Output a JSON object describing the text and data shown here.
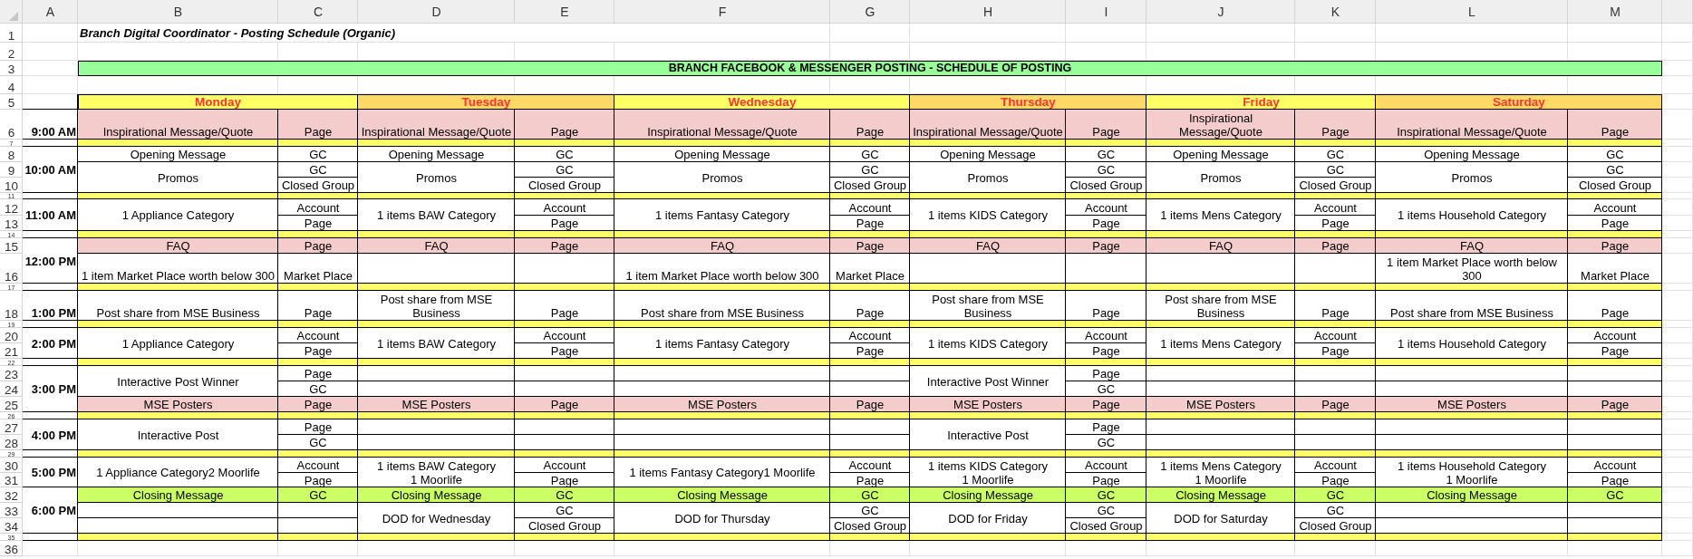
{
  "column_headers": [
    "A",
    "B",
    "C",
    "D",
    "E",
    "F",
    "G",
    "H",
    "I",
    "J",
    "K",
    "L",
    "M"
  ],
  "row_numbers": [
    "1",
    "2",
    "3",
    "4",
    "5",
    "6",
    "7",
    "8",
    "9",
    "10",
    "11",
    "12",
    "13",
    "14",
    "15",
    "16",
    "17",
    "18",
    "19",
    "20",
    "21",
    "22",
    "23",
    "24",
    "25",
    "26",
    "27",
    "28",
    "29",
    "30",
    "31",
    "32",
    "33",
    "34",
    "35",
    "36"
  ],
  "title": "Branch Digital Coordinator - Posting Schedule (Organic)",
  "banner": "BRANCH FACEBOOK & MESSENGER POSTING - SCHEDULE OF POSTING",
  "time_slots": [
    "9:00 AM",
    "10:00 AM",
    "11:00 AM",
    "12:00 PM",
    "1:00 PM",
    "2:00 PM",
    "3:00 PM",
    "4:00 PM",
    "5:00 PM",
    "6:00 PM"
  ],
  "days": [
    {
      "name": "Monday",
      "color": "#ffff66",
      "entries": [
        {
          "kind": "highlight",
          "post": "Inspirational Message/Quote",
          "channels": [
            "Page"
          ]
        },
        {
          "kind": "plain",
          "post": "Opening Message",
          "channels": [
            "GC"
          ]
        },
        {
          "kind": "plain",
          "post": "Promos",
          "channels": [
            "GC",
            "Closed Group"
          ]
        },
        {
          "kind": "plain",
          "post": "1 Appliance Category",
          "channels": [
            "Account",
            "Page"
          ]
        },
        {
          "kind": "highlight",
          "post": "FAQ",
          "channels": [
            "Page"
          ]
        },
        {
          "kind": "plain",
          "post": "1 item Market Place worth below 300",
          "channels": [
            "Market Place"
          ]
        },
        {
          "kind": "plain",
          "post": "Post share from MSE Business",
          "channels": [
            "Page"
          ]
        },
        {
          "kind": "plain",
          "post": "1 Appliance Category",
          "channels": [
            "Account",
            "Page"
          ]
        },
        {
          "kind": "plain",
          "post": "Interactive Post Winner",
          "channels": [
            "Page",
            "GC"
          ]
        },
        {
          "kind": "highlight",
          "post": "MSE Posters",
          "channels": [
            "Page"
          ]
        },
        {
          "kind": "plain",
          "post": "Interactive Post",
          "channels": [
            "Page",
            "GC"
          ]
        },
        {
          "kind": "plain",
          "post": "1 Appliance Category2 Moorlife",
          "channels": [
            "Account",
            "Page"
          ]
        },
        {
          "kind": "closing",
          "post": "Closing Message",
          "channels": [
            "GC"
          ]
        },
        {
          "kind": "plain"
        }
      ]
    },
    {
      "name": "Tuesday",
      "color": "#ffd966",
      "entries": [
        {
          "kind": "highlight",
          "post": "Inspirational Message/Quote",
          "channels": [
            "Page"
          ]
        },
        {
          "kind": "plain",
          "post": "Opening Message",
          "channels": [
            "GC"
          ]
        },
        {
          "kind": "plain",
          "post": "Promos",
          "channels": [
            "GC",
            "Closed Group"
          ]
        },
        {
          "kind": "plain",
          "post": "1 items BAW Category",
          "channels": [
            "Account",
            "Page"
          ]
        },
        {
          "kind": "highlight",
          "post": "FAQ",
          "channels": [
            "Page"
          ]
        },
        {
          "kind": "plain"
        },
        {
          "kind": "plain",
          "post": "Post share from MSE Business",
          "channels": [
            "Page"
          ]
        },
        {
          "kind": "plain",
          "post": "1 items BAW Category",
          "channels": [
            "Account",
            "Page"
          ]
        },
        {
          "kind": "plain"
        },
        {
          "kind": "highlight",
          "post": "MSE Posters",
          "channels": [
            "Page"
          ]
        },
        {
          "kind": "plain"
        },
        {
          "kind": "plain",
          "post": "1 items BAW Category\n1 Moorlife",
          "channels": [
            "Account",
            "Page"
          ]
        },
        {
          "kind": "closing",
          "post": "Closing Message",
          "channels": [
            "GC"
          ]
        },
        {
          "kind": "plain",
          "post": "DOD for Wednesday",
          "channels": [
            "GC",
            "Closed Group"
          ]
        }
      ]
    },
    {
      "name": "Wednesday",
      "color": "#ffff66",
      "entries": [
        {
          "kind": "highlight",
          "post": "Inspirational Message/Quote",
          "channels": [
            "Page"
          ]
        },
        {
          "kind": "plain",
          "post": "Opening Message",
          "channels": [
            "GC"
          ]
        },
        {
          "kind": "plain",
          "post": "Promos",
          "channels": [
            "GC",
            "Closed Group"
          ]
        },
        {
          "kind": "plain",
          "post": "1 items Fantasy Category",
          "channels": [
            "Account",
            "Page"
          ]
        },
        {
          "kind": "highlight",
          "post": "FAQ",
          "channels": [
            "Page"
          ]
        },
        {
          "kind": "plain",
          "post": "1 item Market Place worth below 300",
          "channels": [
            "Market Place"
          ]
        },
        {
          "kind": "plain",
          "post": "Post share from MSE Business",
          "channels": [
            "Page"
          ]
        },
        {
          "kind": "plain",
          "post": "1 items Fantasy Category",
          "channels": [
            "Account",
            "Page"
          ]
        },
        {
          "kind": "plain"
        },
        {
          "kind": "highlight",
          "post": "MSE Posters",
          "channels": [
            "Page"
          ]
        },
        {
          "kind": "plain"
        },
        {
          "kind": "plain",
          "post": "1 items Fantasy Category1 Moorlife",
          "channels": [
            "Account",
            "Page"
          ]
        },
        {
          "kind": "closing",
          "post": "Closing Message",
          "channels": [
            "GC"
          ]
        },
        {
          "kind": "plain",
          "post": "DOD for Thursday",
          "channels": [
            "GC",
            "Closed Group"
          ]
        }
      ]
    },
    {
      "name": "Thursday",
      "color": "#ffd966",
      "entries": [
        {
          "kind": "highlight",
          "post": "Inspirational Message/Quote",
          "channels": [
            "Page"
          ]
        },
        {
          "kind": "plain",
          "post": "Opening Message",
          "channels": [
            "GC"
          ]
        },
        {
          "kind": "plain",
          "post": "Promos",
          "channels": [
            "GC",
            "Closed Group"
          ]
        },
        {
          "kind": "plain",
          "post": "1 items KIDS Category",
          "channels": [
            "Account",
            "Page"
          ]
        },
        {
          "kind": "highlight",
          "post": "FAQ",
          "channels": [
            "Page"
          ]
        },
        {
          "kind": "plain"
        },
        {
          "kind": "plain",
          "post": "Post share from MSE Business",
          "channels": [
            "Page"
          ]
        },
        {
          "kind": "plain",
          "post": "1 items KIDS Category",
          "channels": [
            "Account",
            "Page"
          ]
        },
        {
          "kind": "plain",
          "post": "Interactive Post Winner",
          "channels": [
            "Page",
            "GC"
          ]
        },
        {
          "kind": "highlight",
          "post": "MSE Posters",
          "channels": [
            "Page"
          ]
        },
        {
          "kind": "plain",
          "post": "Interactive Post",
          "channels": [
            "Page",
            "GC"
          ]
        },
        {
          "kind": "plain",
          "post": "1 items KIDS Category\n1 Moorlife",
          "channels": [
            "Account",
            "Page"
          ]
        },
        {
          "kind": "closing",
          "post": "Closing Message",
          "channels": [
            "GC"
          ]
        },
        {
          "kind": "plain",
          "post": "DOD for Friday",
          "channels": [
            "GC",
            "Closed Group"
          ]
        }
      ]
    },
    {
      "name": "Friday",
      "color": "#ffff66",
      "entries": [
        {
          "kind": "highlight",
          "post": "Inspirational Message/Quote",
          "channels": [
            "Page"
          ]
        },
        {
          "kind": "plain",
          "post": "Opening Message",
          "channels": [
            "GC"
          ]
        },
        {
          "kind": "plain",
          "post": "Promos",
          "channels": [
            "GC",
            "Closed Group"
          ]
        },
        {
          "kind": "plain",
          "post": "1 items Mens Category",
          "channels": [
            "Account",
            "Page"
          ]
        },
        {
          "kind": "highlight",
          "post": "FAQ",
          "channels": [
            "Page"
          ]
        },
        {
          "kind": "plain"
        },
        {
          "kind": "plain",
          "post": "Post share from MSE Business",
          "channels": [
            "Page"
          ]
        },
        {
          "kind": "plain",
          "post": "1 items Mens Category",
          "channels": [
            "Account",
            "Page"
          ]
        },
        {
          "kind": "plain"
        },
        {
          "kind": "highlight",
          "post": "MSE Posters",
          "channels": [
            "Page"
          ]
        },
        {
          "kind": "plain"
        },
        {
          "kind": "plain",
          "post": "1 items Mens Category\n1 Moorlife",
          "channels": [
            "Account",
            "Page"
          ]
        },
        {
          "kind": "closing",
          "post": "Closing Message",
          "channels": [
            "GC"
          ]
        },
        {
          "kind": "plain",
          "post": "DOD for Saturday",
          "channels": [
            "GC",
            "Closed Group"
          ]
        }
      ]
    },
    {
      "name": "Saturday",
      "color": "#ffd966",
      "entries": [
        {
          "kind": "highlight",
          "post": "Inspirational Message/Quote",
          "channels": [
            "Page"
          ]
        },
        {
          "kind": "plain",
          "post": "Opening Message",
          "channels": [
            "GC"
          ]
        },
        {
          "kind": "plain",
          "post": "Promos",
          "channels": [
            "GC",
            "Closed Group"
          ]
        },
        {
          "kind": "plain",
          "post": "1 items Household Category",
          "channels": [
            "Account",
            "Page"
          ]
        },
        {
          "kind": "highlight",
          "post": "FAQ",
          "channels": [
            "Page"
          ]
        },
        {
          "kind": "plain",
          "post": "1 item Market Place worth below 300",
          "channels": [
            "Market Place"
          ]
        },
        {
          "kind": "plain",
          "post": "Post share from MSE Business",
          "channels": [
            "Page"
          ]
        },
        {
          "kind": "plain",
          "post": "1 items Household Category",
          "channels": [
            "Account",
            "Page"
          ]
        },
        {
          "kind": "plain"
        },
        {
          "kind": "highlight",
          "post": "MSE Posters",
          "channels": [
            "Page"
          ]
        },
        {
          "kind": "plain"
        },
        {
          "kind": "plain",
          "post": "1 items Household Category\n1 Moorlife",
          "channels": [
            "Account",
            "Page"
          ]
        },
        {
          "kind": "closing",
          "post": "Closing Message",
          "channels": [
            "GC"
          ]
        },
        {
          "kind": "plain"
        }
      ]
    }
  ]
}
